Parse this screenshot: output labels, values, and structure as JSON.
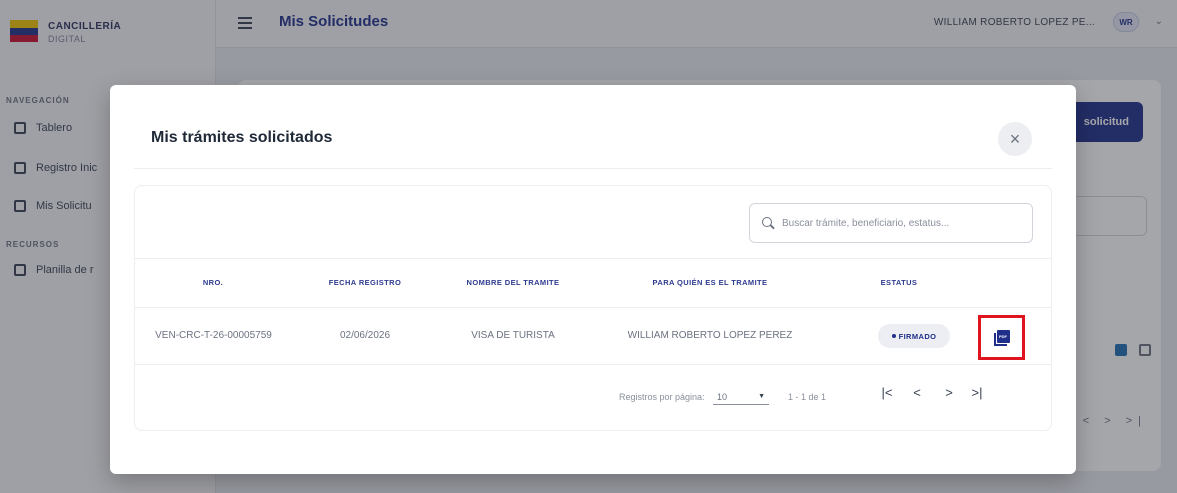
{
  "sidebar": {
    "brand_title": "CANCILLERÍA",
    "brand_sub": "DIGITAL",
    "section_navigation": "NAVEGACIÓN",
    "section_resources": "RECURSOS",
    "items": [
      {
        "label": "Tablero"
      },
      {
        "label": "Registro Inic"
      },
      {
        "label": "Mis Solicitu"
      },
      {
        "label": "Planilla de r"
      }
    ]
  },
  "topbar": {
    "title": "Mis Solicitudes",
    "user_name": "WILLIAM ROBERTO LOPEZ PE...",
    "avatar_initials": "WR"
  },
  "background": {
    "new_button_label": "solicitud"
  },
  "modal": {
    "title": "Mis trámites solicitados",
    "close_symbol": "×",
    "search": {
      "placeholder": "Buscar trámite, beneficiario, estatus..."
    },
    "columns": [
      "NRO.",
      "FECHA REGISTRO",
      "NOMBRE DEL TRAMITE",
      "PARA QUIÉN ES EL TRAMITE",
      "ESTATUS"
    ],
    "rows": [
      {
        "nro": "VEN-CRC-T-26-00005759",
        "fecha": "02/06/2026",
        "tramite": "VISA DE TURISTA",
        "para_quien": "WILLIAM ROBERTO LOPEZ PEREZ",
        "estatus": "FIRMADO",
        "action_icon": "pdf-icon"
      }
    ],
    "pagination": {
      "rows_per_page_label": "Registros por página:",
      "rows_per_page_value": "10",
      "range_text": "1 - 1 de 1",
      "first": "|<",
      "prev": "<",
      "next": ">",
      "last": ">|"
    }
  },
  "colors": {
    "primary": "#1f2f8a",
    "highlight": "#e0141e"
  }
}
